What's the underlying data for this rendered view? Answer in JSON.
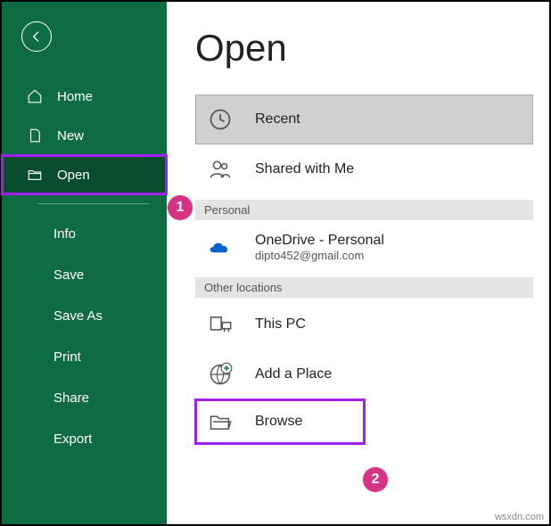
{
  "page": {
    "title": "Open"
  },
  "sidebar": {
    "primary": [
      {
        "label": "Home"
      },
      {
        "label": "New"
      },
      {
        "label": "Open"
      }
    ],
    "secondary": [
      {
        "label": "Info"
      },
      {
        "label": "Save"
      },
      {
        "label": "Save As"
      },
      {
        "label": "Print"
      },
      {
        "label": "Share"
      },
      {
        "label": "Export"
      }
    ]
  },
  "options": {
    "recent": "Recent",
    "shared": "Shared with Me",
    "section_personal": "Personal",
    "onedrive_name": "OneDrive - Personal",
    "onedrive_sub": "dipto452@gmail.com",
    "section_other": "Other locations",
    "thispc": "This PC",
    "addplace": "Add a Place",
    "browse": "Browse"
  },
  "callouts": {
    "c1": "1",
    "c2": "2"
  },
  "watermark": "wsxdn.com"
}
